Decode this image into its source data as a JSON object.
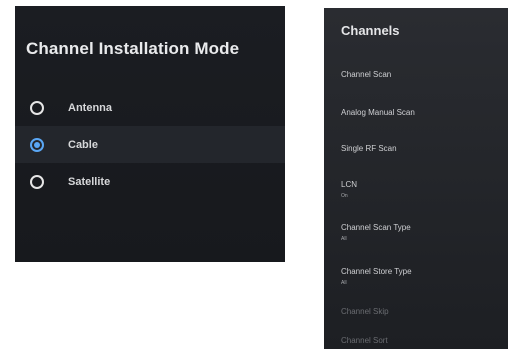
{
  "mode_dialog": {
    "title": "Channel Installation Mode",
    "options": [
      {
        "label": "Antenna",
        "selected": false
      },
      {
        "label": "Cable",
        "selected": true
      },
      {
        "label": "Satellite",
        "selected": false
      }
    ],
    "accent_color": "#5aa7f5"
  },
  "channels_menu": {
    "title": "Channels",
    "items": [
      {
        "label": "Channel Scan"
      },
      {
        "label": "Analog Manual Scan"
      },
      {
        "label": "Single RF Scan"
      },
      {
        "label": "LCN",
        "value": "On"
      },
      {
        "label": "Channel Scan Type",
        "value": "All"
      },
      {
        "label": "Channel Store Type",
        "value": "All"
      },
      {
        "label": "Channel Skip"
      },
      {
        "label": "Channel Sort"
      }
    ]
  }
}
